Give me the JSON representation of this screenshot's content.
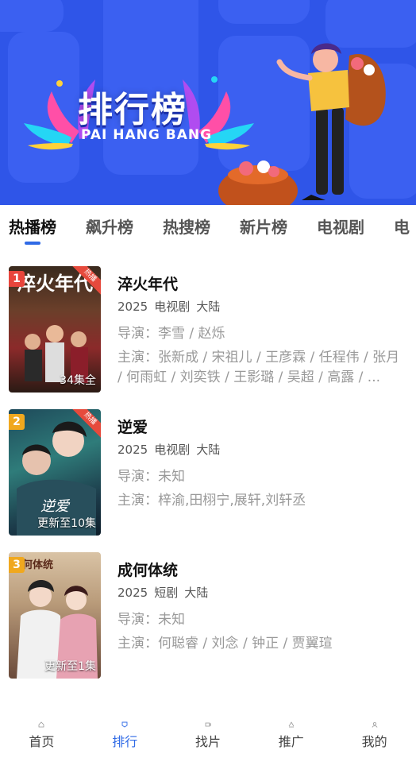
{
  "banner": {
    "title": "排行榜",
    "subtitle": "PAI HANG BANG"
  },
  "tabs": [
    {
      "label": "热播榜",
      "active": true
    },
    {
      "label": "飙升榜",
      "active": false
    },
    {
      "label": "热搜榜",
      "active": false
    },
    {
      "label": "新片榜",
      "active": false
    },
    {
      "label": "电视剧",
      "active": false
    },
    {
      "label": "电",
      "active": false
    }
  ],
  "items": [
    {
      "rank": "1",
      "rank_color": "#e8453c",
      "hot_badge": "热播",
      "poster_text": "34集全",
      "poster_art": "淬火年代",
      "title": "淬火年代",
      "year": "2025",
      "type": "电视剧",
      "region": "大陆",
      "director": "导演：李雪 / 赵烁",
      "cast": "主演：张新成 / 宋祖儿 / 王彦霖 / 任程伟 / 张月 / 何雨虹 / 刘奕铁 / 王影璐 / 吴超 / 高露 / ..."
    },
    {
      "rank": "2",
      "rank_color": "#f0a81e",
      "hot_badge": "热播",
      "poster_text": "更新至10集",
      "poster_art": "逆爱",
      "title": "逆爱",
      "year": "2025",
      "type": "电视剧",
      "region": "大陆",
      "director": "导演：未知",
      "cast": "主演：梓渝,田栩宁,展轩,刘轩丞"
    },
    {
      "rank": "3",
      "rank_color": "#f0a81e",
      "hot_badge": "",
      "poster_text": "更新至1集",
      "poster_art": "成何体统",
      "title": "成何体统",
      "year": "2025",
      "type": "短剧",
      "region": "大陆",
      "director": "导演：未知",
      "cast": "主演：何聪睿 / 刘念 / 钟正 / 贾翼瑄"
    }
  ],
  "nav": [
    {
      "label": "首页",
      "icon": "home-icon",
      "active": false
    },
    {
      "label": "排行",
      "icon": "ranking-icon",
      "active": true
    },
    {
      "label": "找片",
      "icon": "find-movie-icon",
      "active": false
    },
    {
      "label": "推广",
      "icon": "promote-icon",
      "active": false
    },
    {
      "label": "我的",
      "icon": "profile-icon",
      "active": false
    }
  ],
  "colors": {
    "accent": "#2f6ae6",
    "banner_bg": "#2f55e8"
  }
}
